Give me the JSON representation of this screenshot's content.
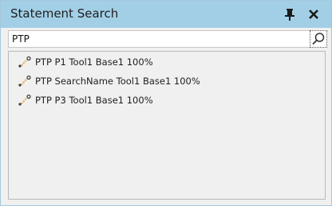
{
  "window": {
    "title": "Statement Search",
    "pin_icon": "pin-icon",
    "close_icon": "close-icon"
  },
  "search": {
    "value": "PTP",
    "button_icon": "search-icon"
  },
  "results": [
    {
      "label": "PTP P1 Tool1 Base1 100%",
      "icon": "ptp-motion-icon"
    },
    {
      "label": "PTP SearchName Tool1 Base1 100%",
      "icon": "ptp-motion-icon"
    },
    {
      "label": "PTP P3 Tool1 Base1 100%",
      "icon": "ptp-motion-icon"
    }
  ],
  "colors": {
    "titlebar": "#a2cfe6",
    "panel_bg": "#f0f0f0",
    "icon_orange": "#f0a020",
    "icon_dark": "#3a3a3a"
  }
}
